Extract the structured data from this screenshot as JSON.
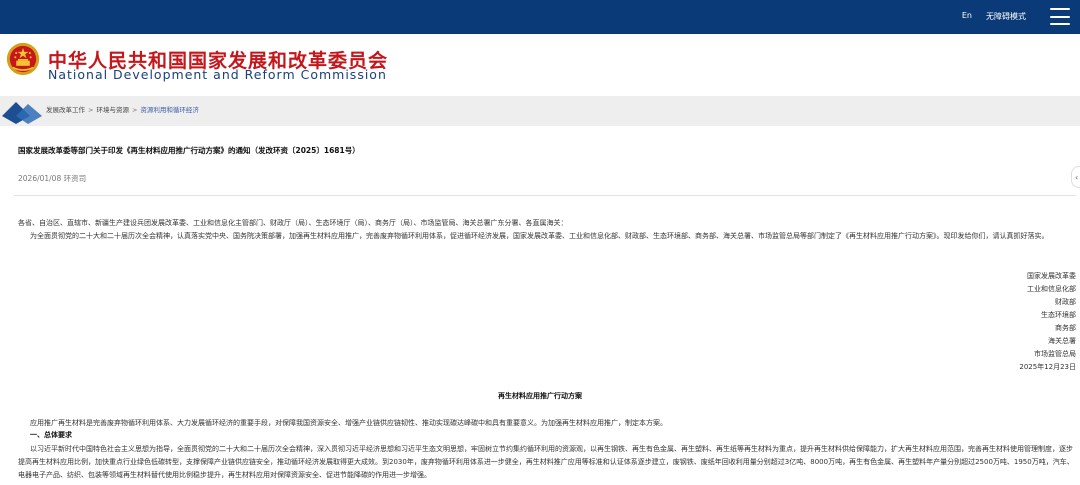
{
  "topbar": {
    "lang_link": "En",
    "accessibility_link": "无障碍模式"
  },
  "header": {
    "site_name_cn": "中华人民共和国国家发展和改革委员会",
    "site_name_en": "National Development and Reform Commission"
  },
  "breadcrumb": {
    "items": [
      "发展改革工作",
      "环境与资源",
      "资源利用和循环经济"
    ],
    "separator": ">"
  },
  "article": {
    "title": "国家发展改革委等部门关于印发《再生材料应用推广行动方案》的通知（发改环资〔2025〕1681号）",
    "meta": "2026/01/08 环资司",
    "recipients": "各省、自治区、直辖市、新疆生产建设兵团发展改革委、工业和信息化主管部门、财政厅（局）、生态环境厅（局）、商务厅（局）、市场监管局、海关总署广东分署、各直属海关：",
    "intro": "为全面贯彻党的二十大和二十届历次全会精神，认真落实党中央、国务院决策部署，加强再生材料应用推广，完善废弃物循环利用体系，促进循环经济发展，国家发展改革委、工业和信息化部、财政部、生态环境部、商务部、海关总署、市场监管总局等部门制定了《再生材料应用推广行动方案》。现印发给你们，请认真抓好落实。",
    "signers": [
      "国家发展改革委",
      "工业和信息化部",
      "财政部",
      "生态环境部",
      "商务部",
      "海关总署",
      "市场监管总局"
    ],
    "date": "2025年12月23日",
    "plan_title": "再生材料应用推广行动方案",
    "plan_intro": "应用推广再生材料是完善废弃物循环利用体系、大力发展循环经济的重要手段，对保障我国资源安全、增强产业链供应链韧性、推动实现碳达峰碳中和具有重要意义。为加强再生材料应用推广，制定本方案。",
    "section1_heading": "一、总体要求",
    "section1_text": "以习近平新时代中国特色社会主义思想为指导，全面贯彻党的二十大和二十届历次全会精神，深入贯彻习近平经济思想和习近平生态文明思想，牢固树立节约集约循环利用的资源观，以再生钢铁、再生有色金属、再生塑料、再生纸等再生材料为重点，提升再生材料供给保障能力，扩大再生材料应用范围，完善再生材料使用管理制度，逐步提高再生材料应用比例，加快重点行业绿色低碳转型，支撑保障产业链供应链安全，推动循环经济发展取得更大成效。到2030年，废弃物循环利用体系进一步健全，再生材料推广应用等标准和认证体系逐步建立，废钢铁、废纸年回收利用量分别超过3亿吨、8000万吨，再生有色金属、再生塑料年产量分别超过2500万吨、1950万吨，汽车、电器电子产品、纺织、包装等领域再生材料替代使用比例稳步提升，再生材料应用对保障资源安全、促进节能降碳的作用进一步增强。"
  },
  "icons": {
    "menu": "hamburger-menu-icon",
    "emblem": "national-emblem-icon",
    "side": "chevron-left-icon"
  },
  "colors": {
    "topbar": "#0b3a78",
    "brand_red": "#c3171c",
    "brand_blue": "#1a3f7c",
    "crumb_band": "#eeeeee",
    "link": "#3b5fa6"
  }
}
